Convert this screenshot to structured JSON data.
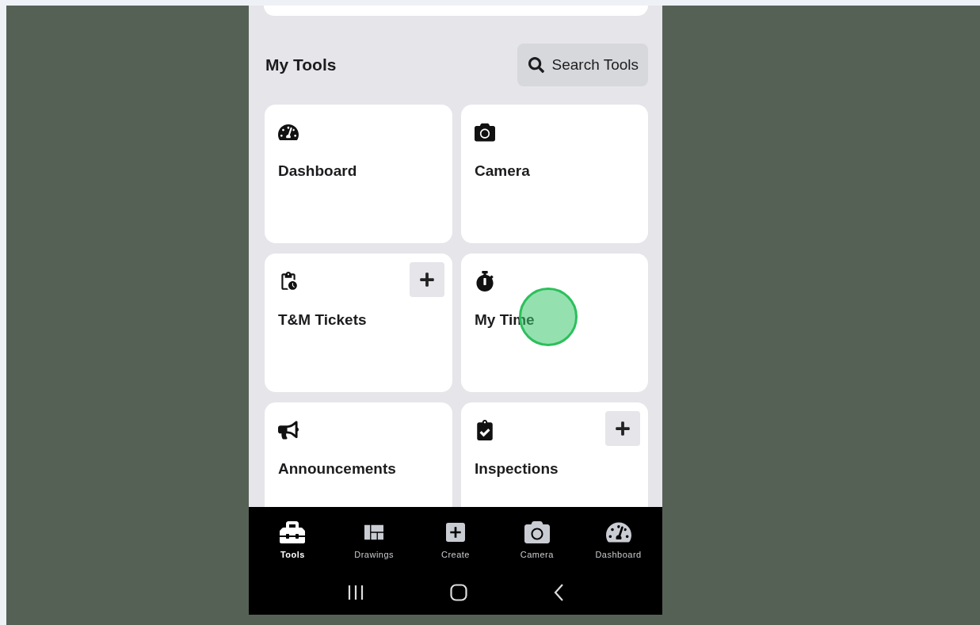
{
  "header": {
    "title": "My Tools",
    "search_button": "Search Tools"
  },
  "tools": [
    {
      "label": "Dashboard",
      "add_button": false
    },
    {
      "label": "Camera",
      "add_button": false
    },
    {
      "label": "T&M Tickets",
      "add_button": true
    },
    {
      "label": "My Time",
      "add_button": false
    },
    {
      "label": "Announcements",
      "add_button": false
    },
    {
      "label": "Inspections",
      "add_button": true
    }
  ],
  "bottom_nav": [
    {
      "label": "Tools",
      "selected": true
    },
    {
      "label": "Drawings",
      "selected": false
    },
    {
      "label": "Create",
      "selected": false
    },
    {
      "label": "Camera",
      "selected": false
    },
    {
      "label": "Dashboard",
      "selected": false
    }
  ]
}
